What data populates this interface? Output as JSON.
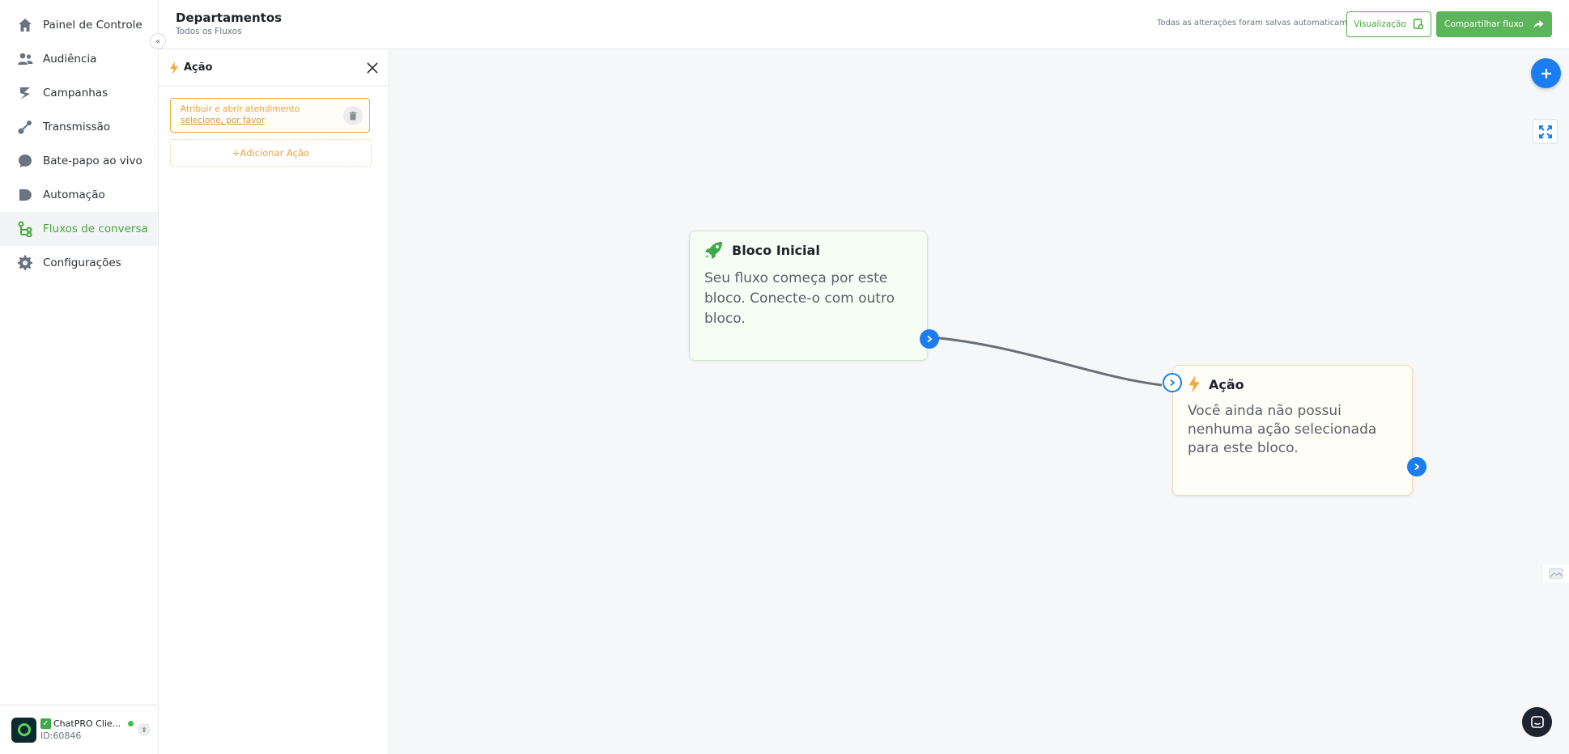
{
  "sidebar": {
    "items": [
      {
        "label": "Painel de Controle",
        "icon": "home-icon"
      },
      {
        "label": "Audiência",
        "icon": "users-icon"
      },
      {
        "label": "Campanhas",
        "icon": "campaign-icon"
      },
      {
        "label": "Transmissão",
        "icon": "broadcast-icon"
      },
      {
        "label": "Bate-papo ao vivo",
        "icon": "chat-bubble-icon"
      },
      {
        "label": "Automação",
        "icon": "automation-icon"
      },
      {
        "label": "Fluxos de conversa",
        "icon": "flow-icon"
      },
      {
        "label": "Configurações",
        "icon": "gear-icon"
      }
    ],
    "active_index": 6,
    "account": {
      "name": "ChatPRO Clie...",
      "id": "ID:60846"
    }
  },
  "header": {
    "title": "Departamentos",
    "subtitle": "Todos os Fluxos",
    "save_status": "Todas as alterações foram salvas automaticamente",
    "preview_label": "Visualização",
    "share_label": "Compartilhar fluxo"
  },
  "panel": {
    "title": "Ação",
    "action": {
      "name": "Atribuir e abrir atendimento",
      "hint": "selecione, por favor"
    },
    "add_label": "+Adicionar Ação"
  },
  "canvas": {
    "start_node": {
      "title": "Bloco Inicial",
      "body": "Seu fluxo começa por este bloco. Conecte-o com outro bloco."
    },
    "action_node": {
      "title": "Ação",
      "body": "Você ainda não possui nenhuma ação selecionada para este bloco."
    }
  },
  "colors": {
    "brand_green": "#44a83a",
    "accent_blue": "#1c7df1",
    "action_orange": "#f0a93a"
  }
}
